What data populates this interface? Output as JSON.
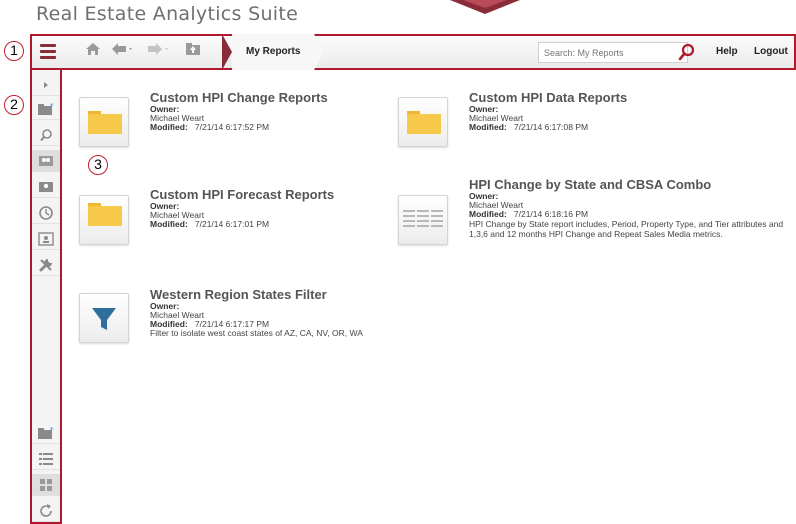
{
  "app": {
    "title": "Real Estate Analytics Suite"
  },
  "toolbar": {
    "breadcrumb": "My Reports",
    "search_placeholder": "Search: My Reports",
    "help_label": "Help",
    "logout_label": "Logout"
  },
  "callouts": [
    "1",
    "2",
    "3"
  ],
  "labels": {
    "owner": "Owner:",
    "modified": "Modified:"
  },
  "reports": [
    {
      "title": "Custom HPI Change Reports",
      "owner": "Michael Weart",
      "modified": "7/21/14 6:17:52 PM",
      "description": "",
      "icon": "folder-icon"
    },
    {
      "title": "Custom HPI Data Reports",
      "owner": "Michael Weart",
      "modified": "7/21/14 6:17:08 PM",
      "description": "",
      "icon": "folder-icon"
    },
    {
      "title": "Custom HPI Forecast Reports",
      "owner": "Michael Weart",
      "modified": "7/21/14 6:17:01 PM",
      "description": "",
      "icon": "folder-icon"
    },
    {
      "title": "HPI Change by State and CBSA Combo",
      "owner": "Michael Weart",
      "modified": "7/21/14 6:18:16 PM",
      "description": "HPI Change by State report includes, Period, Property Type, and Tier attributes and 1,3,6 and 12 months HPI Change and Repeat Sales Media metrics.",
      "icon": "report-grid-icon"
    },
    {
      "title": "Western Region States Filter",
      "owner": "Michael Weart",
      "modified": "7/21/14 6:17:17 PM",
      "description": "Filter to isolate west coast states of AZ, CA, NV, OR, WA",
      "icon": "filter-icon"
    }
  ],
  "sidebar": {
    "items": [
      "expand-icon",
      "new-folder-icon",
      "search-icon",
      "shared-reports-icon",
      "my-reports-icon",
      "history-icon",
      "profile-icon",
      "tools-icon"
    ],
    "bottom_items": [
      "new-folder-icon",
      "list-view-icon",
      "icon-view-icon",
      "refresh-icon"
    ]
  },
  "colors": {
    "accent": "#b0182b",
    "brand": "#8a2b3a",
    "folder": "#f6c94a"
  }
}
